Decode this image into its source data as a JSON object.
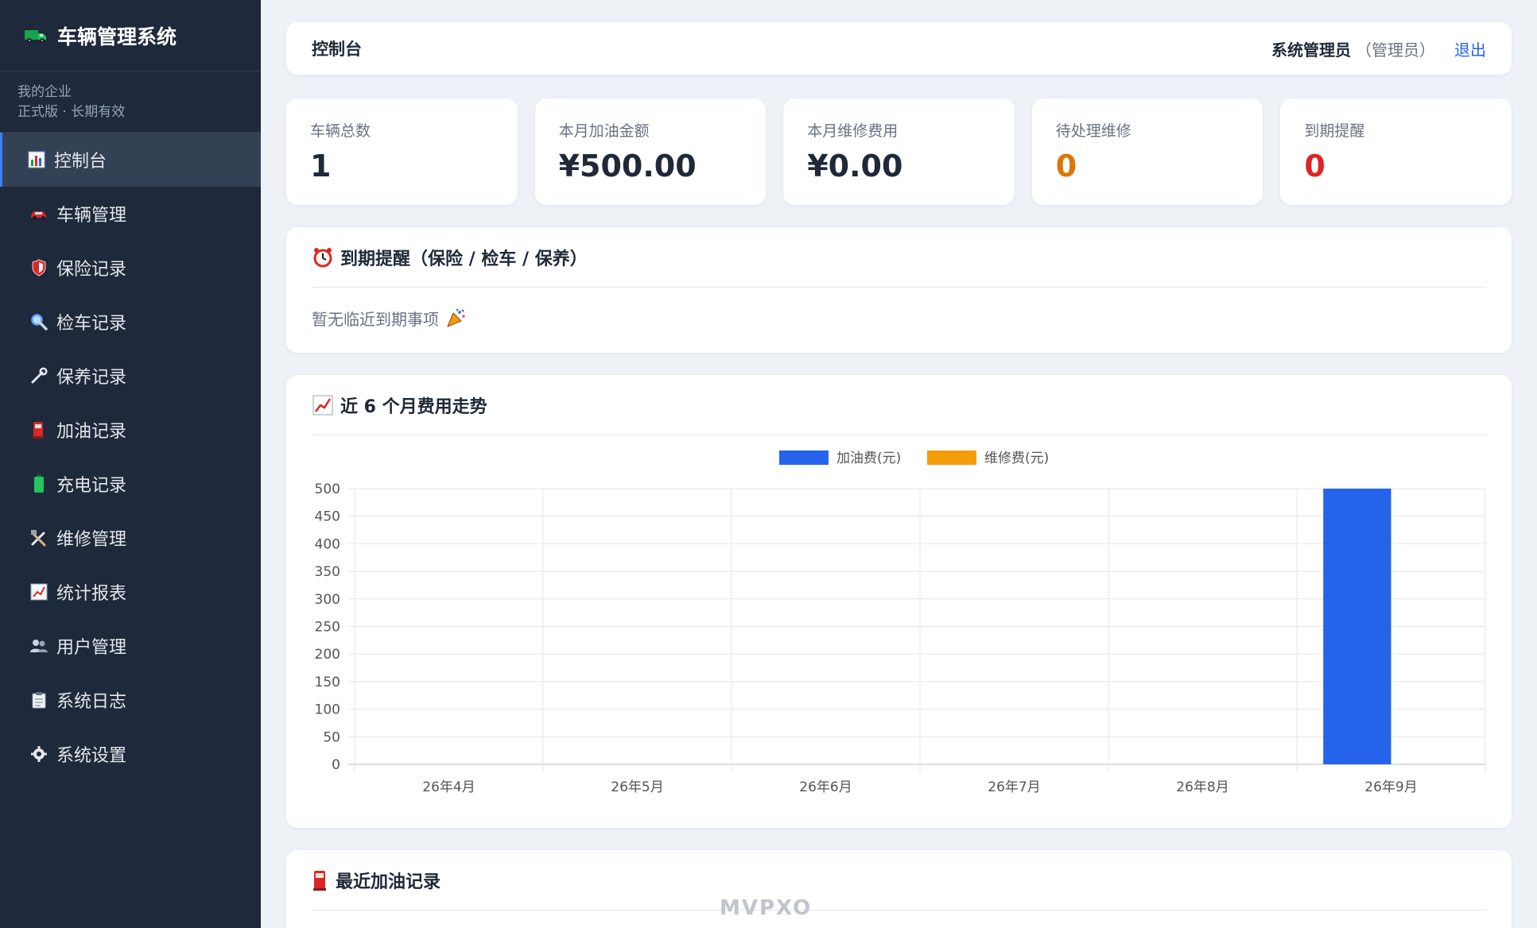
{
  "app": {
    "title": "车辆管理系统",
    "company_name": "我的企业",
    "license": "正式版 · 长期有效"
  },
  "sidebar": {
    "items": [
      {
        "label": "控制台",
        "icon": "bar-chart-icon",
        "active": true
      },
      {
        "label": "车辆管理",
        "icon": "car-icon"
      },
      {
        "label": "保险记录",
        "icon": "shield-icon"
      },
      {
        "label": "检车记录",
        "icon": "magnifier-icon"
      },
      {
        "label": "保养记录",
        "icon": "wrench-icon"
      },
      {
        "label": "加油记录",
        "icon": "fuel-pump-icon"
      },
      {
        "label": "充电记录",
        "icon": "battery-icon"
      },
      {
        "label": "维修管理",
        "icon": "tools-icon"
      },
      {
        "label": "统计报表",
        "icon": "line-chart-icon"
      },
      {
        "label": "用户管理",
        "icon": "users-icon"
      },
      {
        "label": "系统日志",
        "icon": "clipboard-icon"
      },
      {
        "label": "系统设置",
        "icon": "gear-icon"
      }
    ]
  },
  "header": {
    "title": "控制台",
    "username": "系统管理员",
    "role": "（管理员）",
    "logout": "退出"
  },
  "stats": [
    {
      "label": "车辆总数",
      "value": "1",
      "color": "#1f2937"
    },
    {
      "label": "本月加油金额",
      "value": "¥500.00",
      "color": "#1f2937"
    },
    {
      "label": "本月维修费用",
      "value": "¥0.00",
      "color": "#1f2937"
    },
    {
      "label": "待处理维修",
      "value": "0",
      "color": "#d97706"
    },
    {
      "label": "到期提醒",
      "value": "0",
      "color": "#dc2626"
    }
  ],
  "reminder": {
    "title": "到期提醒（保险 / 检车 / 保养）",
    "empty_text": "暂无临近到期事项"
  },
  "trend": {
    "title": "近 6 个月费用走势"
  },
  "recent_fuel": {
    "title": "最近加油记录"
  },
  "watermark": "MVPXO",
  "chart_data": {
    "type": "bar",
    "categories": [
      "26年4月",
      "26年5月",
      "26年6月",
      "26年7月",
      "26年8月",
      "26年9月"
    ],
    "series": [
      {
        "name": "加油费(元)",
        "values": [
          0,
          0,
          0,
          0,
          0,
          500
        ],
        "color": "#2563eb"
      },
      {
        "name": "维修费(元)",
        "values": [
          0,
          0,
          0,
          0,
          0,
          0
        ],
        "color": "#f59e0b"
      }
    ],
    "ylim": [
      0,
      500
    ],
    "yticks": [
      0,
      50,
      100,
      150,
      200,
      250,
      300,
      350,
      400,
      450,
      500
    ],
    "legend": "top-center",
    "grid": true
  }
}
